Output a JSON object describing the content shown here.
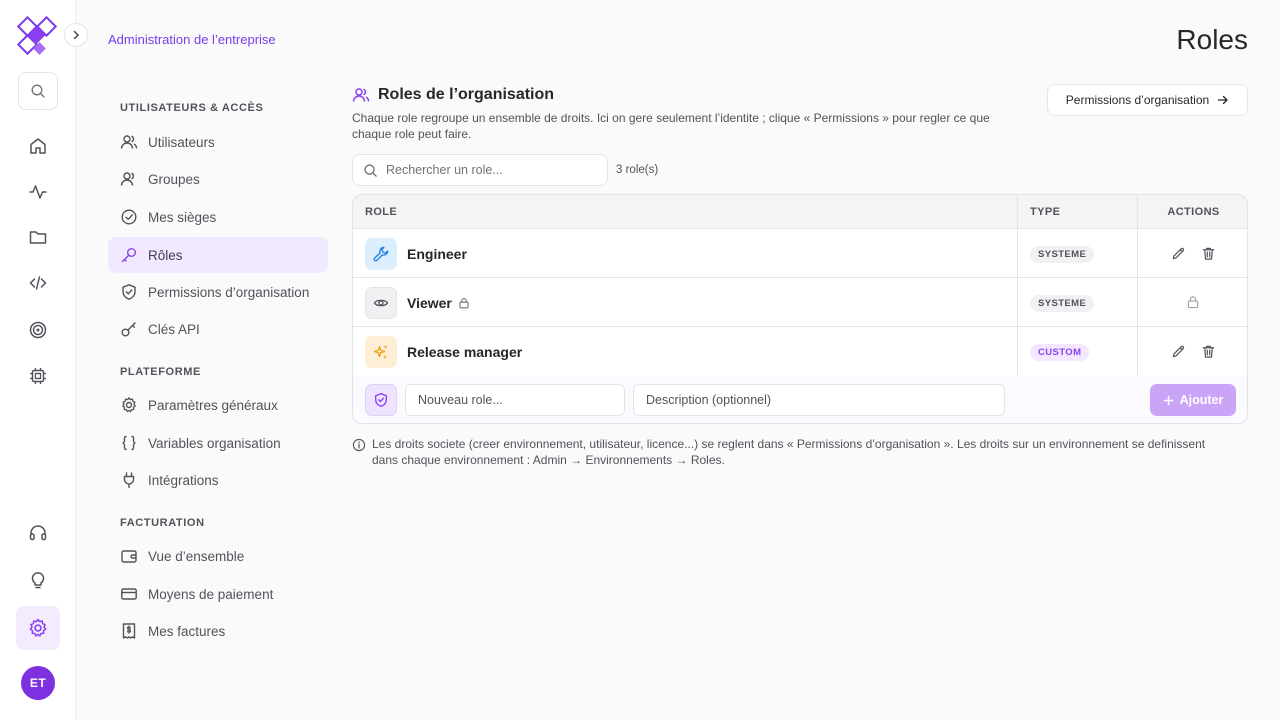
{
  "header": {
    "breadcrumb": "Administration de l’entreprise",
    "title": "Roles"
  },
  "rail": {
    "avatar_initials": "ET",
    "items": [
      "search-icon",
      "home-icon",
      "activity-icon",
      "folder-icon",
      "code-icon",
      "target-icon",
      "chip-icon",
      "headset-icon",
      "lightbulb-icon",
      "settings-icon"
    ],
    "active": "settings-icon"
  },
  "sidebar": {
    "sections": [
      {
        "title": "UTILISATEURS & ACCÈS",
        "items": [
          {
            "label": "Utilisateurs",
            "icon": "users-icon"
          },
          {
            "label": "Groupes",
            "icon": "users-group-icon"
          },
          {
            "label": "Mes sièges",
            "icon": "check-circle-icon"
          },
          {
            "label": "Rôles",
            "icon": "key-icon",
            "active": true
          },
          {
            "label": "Permissions d’organisation",
            "icon": "shield-check-icon"
          },
          {
            "label": "Clés API",
            "icon": "api-key-icon"
          }
        ]
      },
      {
        "title": "PLATEFORME",
        "items": [
          {
            "label": "Paramètres généraux",
            "icon": "gear-icon"
          },
          {
            "label": "Variables organisation",
            "icon": "braces-icon"
          },
          {
            "label": "Intégrations",
            "icon": "plug-icon"
          }
        ]
      },
      {
        "title": "FACTURATION",
        "items": [
          {
            "label": "Vue d’ensemble",
            "icon": "wallet-icon"
          },
          {
            "label": "Moyens de paiement",
            "icon": "credit-card-icon"
          },
          {
            "label": "Mes factures",
            "icon": "invoice-icon"
          }
        ]
      }
    ]
  },
  "main": {
    "card_title": "Roles de l’organisation",
    "card_description": "Chaque role regroupe un ensemble de droits. Ici on gere seulement l’identite ; clique « Permissions » pour regler ce que chaque role peut faire.",
    "permissions_button": "Permissions d’organisation",
    "search_placeholder": "Rechercher un role...",
    "count": "3 role(s)",
    "columns": {
      "role": "ROLE",
      "type": "TYPE",
      "actions": "ACTIONS"
    },
    "rows": [
      {
        "name": "Engineer",
        "type": "SYSTEME",
        "icon": "wrench-icon",
        "locked": false
      },
      {
        "name": "Viewer",
        "type": "SYSTEME",
        "icon": "eye-icon",
        "locked": true
      },
      {
        "name": "Release manager",
        "type": "CUSTOM",
        "icon": "sparkles-icon",
        "locked": false
      }
    ],
    "new_role_placeholder": "Nouveau role...",
    "description_placeholder": "Description (optionnel)",
    "add_button": "Ajouter",
    "info_text": "Les droits societe (creer environnement, utilisateur, licence...) se reglent dans « Permissions d’organisation ». Les droits sur un environnement se definissent dans chaque environnement : Admin → Environnements → Roles."
  },
  "colors": {
    "accent": "#8b3ff0",
    "active_bg": "#f1e9ff",
    "custom_badge": "#f3e8ff",
    "add_button": "#c9a4f7",
    "avatar": "#7c30e0"
  }
}
